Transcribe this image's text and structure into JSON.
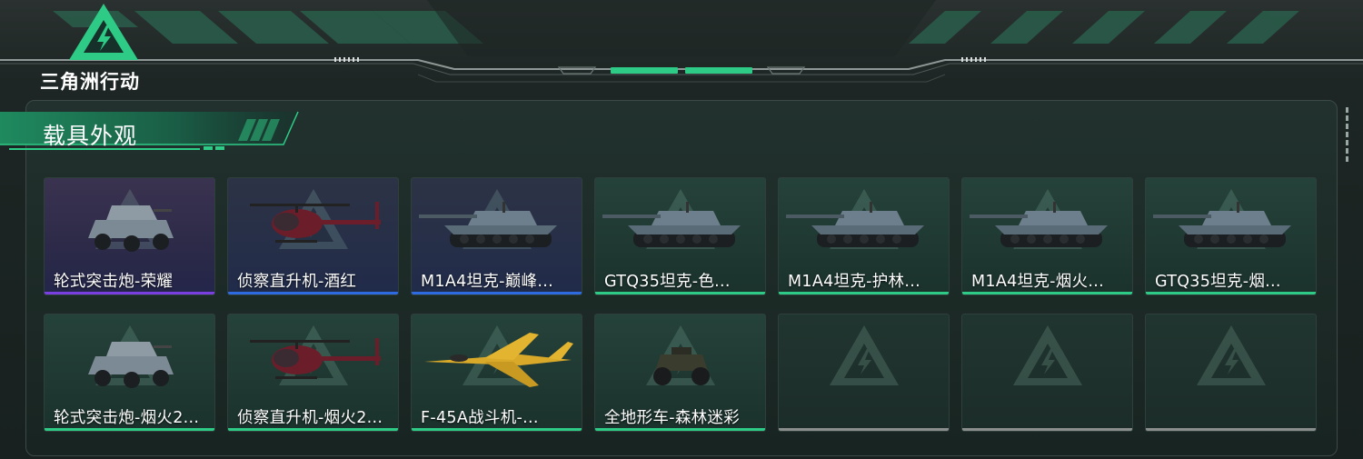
{
  "header": {
    "logo_text": "三角洲行动",
    "accent_color": "#2ecb86"
  },
  "section": {
    "title": "载具外观"
  },
  "rarity_colors": {
    "purple": "#7a3fe0",
    "blue": "#2e6ae0",
    "green": "#2ecb86",
    "empty": "#8a8f8e"
  },
  "vehicles": [
    {
      "name": "轮式突击炮-荣耀",
      "rarity": "purple",
      "type": "wheeled-assault-gun"
    },
    {
      "name": "侦察直升机-酒红",
      "rarity": "blue",
      "type": "scout-helicopter"
    },
    {
      "name": "M1A4坦克-巅峰...",
      "rarity": "blue",
      "type": "tank"
    },
    {
      "name": "GTQ35坦克-色...",
      "rarity": "green",
      "type": "tank"
    },
    {
      "name": "M1A4坦克-护林...",
      "rarity": "green",
      "type": "tank"
    },
    {
      "name": "M1A4坦克-烟火...",
      "rarity": "green",
      "type": "tank"
    },
    {
      "name": "GTQ35坦克-烟...",
      "rarity": "green",
      "type": "tank"
    },
    {
      "name": "轮式突击炮-烟火2...",
      "rarity": "green",
      "type": "wheeled-assault-gun"
    },
    {
      "name": "侦察直升机-烟火2...",
      "rarity": "green",
      "type": "scout-helicopter"
    },
    {
      "name": "F-45A战斗机-...",
      "rarity": "green",
      "type": "fighter-jet"
    },
    {
      "name": "全地形车-森林迷彩",
      "rarity": "green",
      "type": "atv"
    },
    {
      "name": "",
      "rarity": "empty",
      "type": "empty"
    },
    {
      "name": "",
      "rarity": "empty",
      "type": "empty"
    },
    {
      "name": "",
      "rarity": "empty",
      "type": "empty"
    }
  ]
}
